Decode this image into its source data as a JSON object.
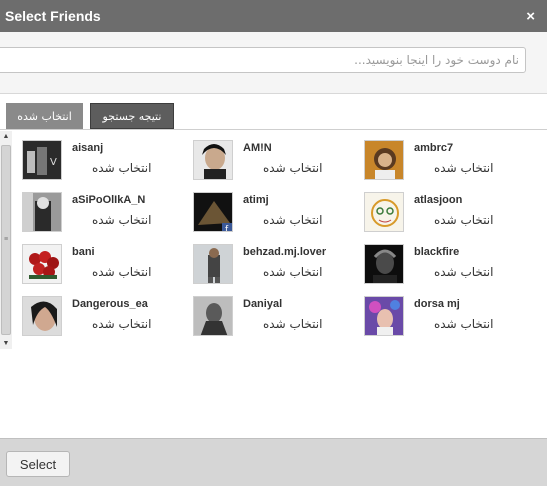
{
  "window": {
    "title": "Select Friends",
    "close_label": "×"
  },
  "search": {
    "placeholder": "نام دوست خود را اینجا بنویسید..."
  },
  "tabs": {
    "selected_label": "انتخاب شده",
    "result_label": "نتیجه جستجو"
  },
  "friends": [
    {
      "name": "aisanj",
      "status": "انتخاب شده"
    },
    {
      "name": "AM!N",
      "status": "انتخاب شده"
    },
    {
      "name": "ambrc7",
      "status": "انتخاب شده"
    },
    {
      "name": "aSiPoOlIkA_N",
      "status": "انتخاب شده"
    },
    {
      "name": "atimj",
      "status": "انتخاب شده"
    },
    {
      "name": "atlasjoon",
      "status": "انتخاب شده"
    },
    {
      "name": "bani",
      "status": "انتخاب شده"
    },
    {
      "name": "behzad.mj.lover",
      "status": "انتخاب شده"
    },
    {
      "name": "blackfire",
      "status": "انتخاب شده"
    },
    {
      "name": "Dangerous_ea",
      "status": "انتخاب شده"
    },
    {
      "name": "Daniyal",
      "status": "انتخاب شده"
    },
    {
      "name": "dorsa mj",
      "status": "انتخاب شده"
    }
  ],
  "footer": {
    "select_label": "Select"
  },
  "colors": {
    "titlebar": "#6d6d6d",
    "footer": "#d6d6d6",
    "tab_active": "#5d5d5d"
  }
}
